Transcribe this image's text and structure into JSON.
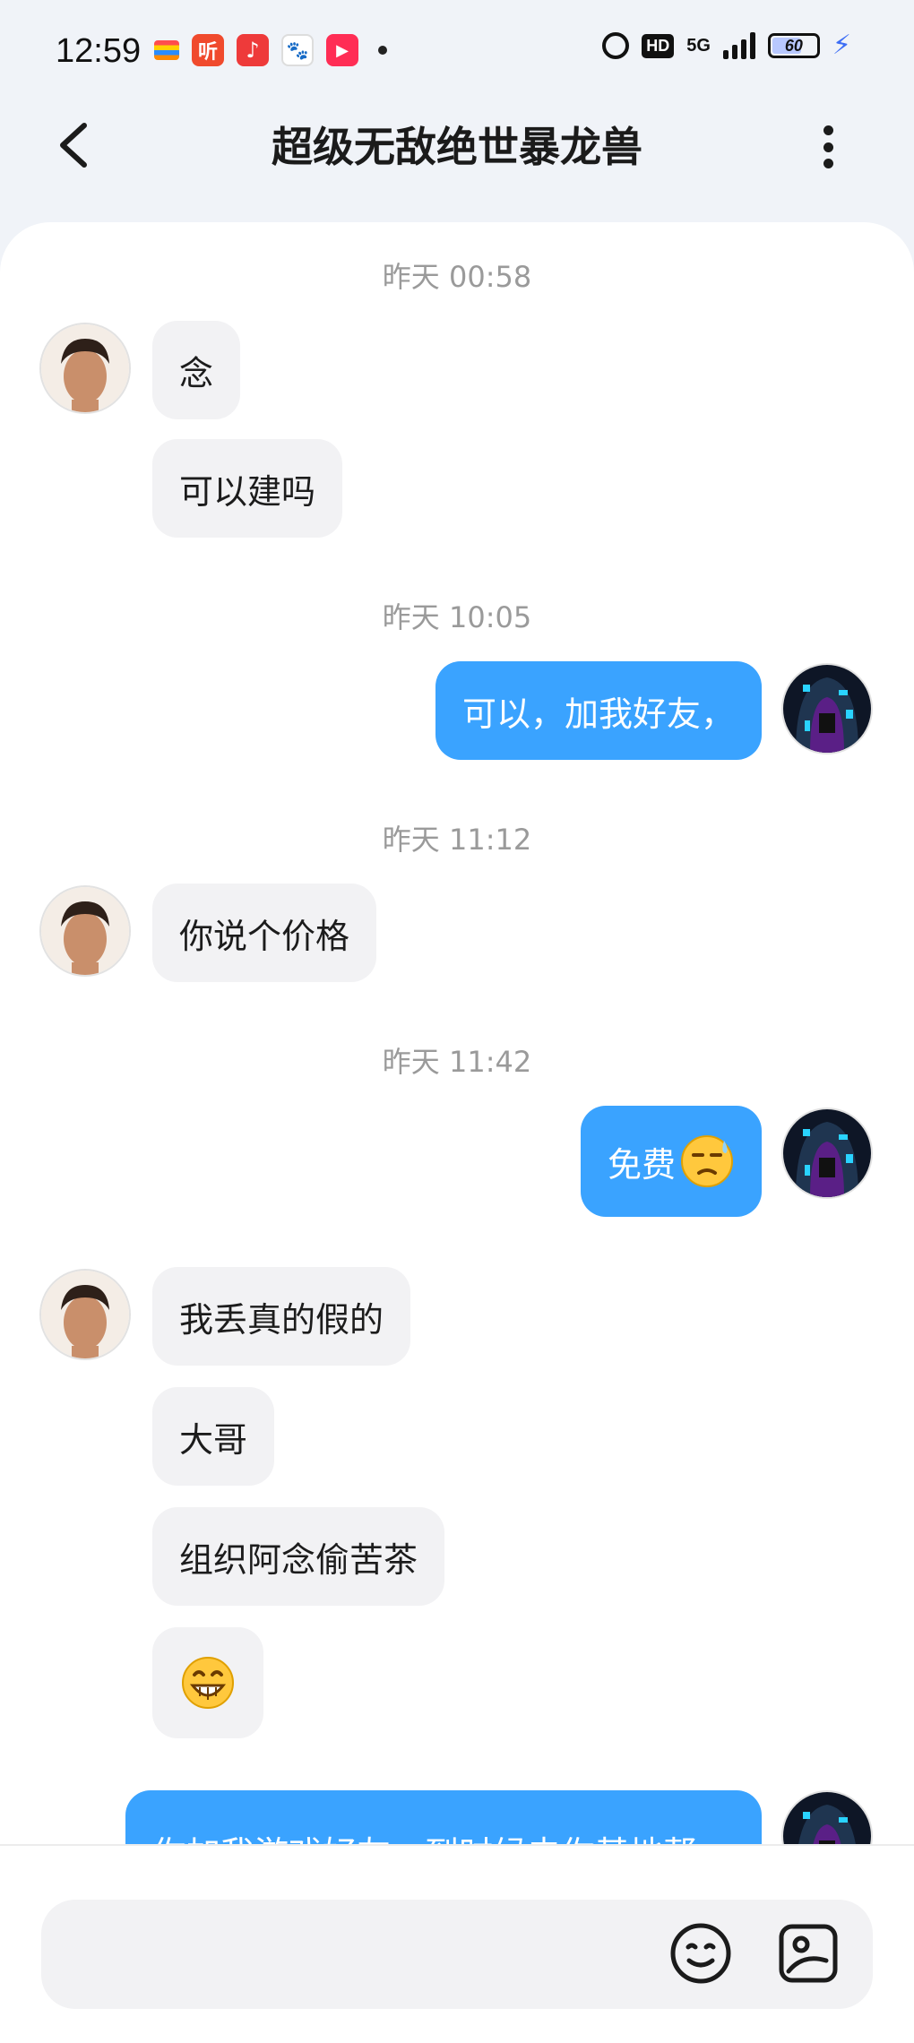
{
  "status_bar": {
    "time": "12:59",
    "network": "5G",
    "battery_level": "60",
    "app_icons": [
      "taobao-flag-icon",
      "ting-audio-icon",
      "music-icon",
      "baidu-icon",
      "video-play-icon"
    ]
  },
  "header": {
    "title": "超级无敌绝世暴龙兽"
  },
  "messages": [
    {
      "type": "timestamp",
      "text": "昨天 00:58"
    },
    {
      "type": "in",
      "text": "念"
    },
    {
      "type": "in",
      "text": "可以建吗"
    },
    {
      "type": "timestamp",
      "text": "昨天 10:05"
    },
    {
      "type": "out",
      "text": "可以，加我好友，"
    },
    {
      "type": "timestamp",
      "text": "昨天 11:12"
    },
    {
      "type": "in",
      "text": "你说个价格"
    },
    {
      "type": "timestamp",
      "text": "昨天 11:42"
    },
    {
      "type": "out",
      "text": "免费",
      "emoji": "sweat-emoji"
    },
    {
      "type": "in",
      "text": "我丢真的假的"
    },
    {
      "type": "in",
      "text": "大哥"
    },
    {
      "type": "in",
      "text": "组织阿念偷苦茶"
    },
    {
      "type": "in",
      "emoji": "grin-emoji"
    },
    {
      "type": "out",
      "text": "你加我游戏好友，到时候去你基地帮"
    }
  ],
  "colors": {
    "outgoing_bubble": "#3aa3ff",
    "incoming_bubble": "#f2f2f4",
    "page_background": "#f0f3f8"
  }
}
